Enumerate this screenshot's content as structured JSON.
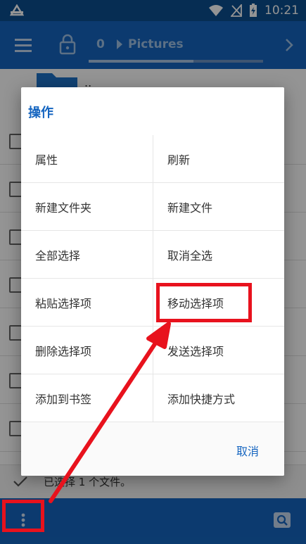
{
  "status_bar": {
    "time": "10:21"
  },
  "toolbar": {
    "count": "0",
    "breadcrumb": "Pictures",
    "scroll_progress": 0.6
  },
  "list": {
    "folder_name": "..",
    "selection_status": "已选择 1 个文件。"
  },
  "dialog": {
    "title": "操作",
    "actions": [
      "属性",
      "刷新",
      "新建文件夹",
      "新建文件",
      "全部选择",
      "取消全选",
      "粘贴选择项",
      "移动选择项",
      "删除选择项",
      "发送选择项",
      "添加到书签",
      "添加快捷方式"
    ],
    "cancel_label": "取消"
  },
  "colors": {
    "primary": "#1565c0",
    "status_bar": "#0b4f8f",
    "annotation": "#e8121d"
  }
}
